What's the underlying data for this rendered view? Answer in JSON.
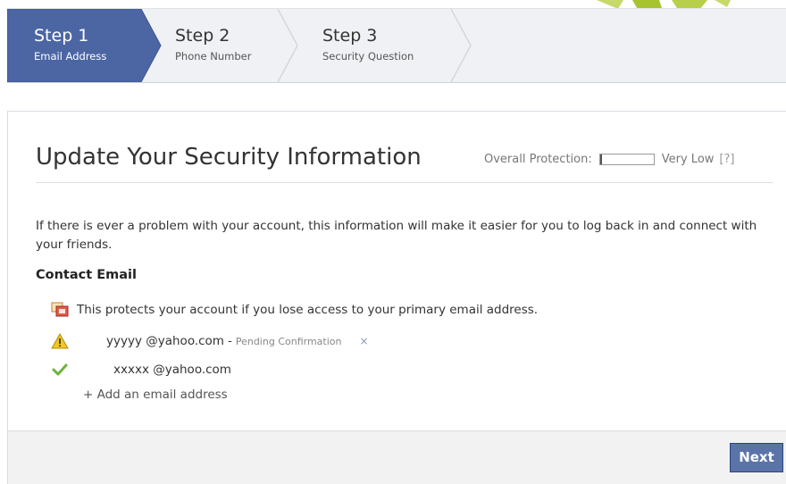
{
  "steps": [
    {
      "title": "Step 1",
      "subtitle": "Email Address",
      "active": true
    },
    {
      "title": "Step 2",
      "subtitle": "Phone Number",
      "active": false
    },
    {
      "title": "Step 3",
      "subtitle": "Security Question",
      "active": false
    }
  ],
  "page": {
    "title": "Update Your Security Information",
    "protection_label": "Overall Protection:",
    "protection_level": "Very Low",
    "protection_fraction": 0.03,
    "help_label": "[?]",
    "intro": "If there is ever a problem with your account, this information will make it easier for you to log back in and connect with your friends."
  },
  "contact_email": {
    "heading": "Contact Email",
    "info_text": "This protects your account if you lose access to your primary email address.",
    "emails": [
      {
        "address": "yyyyy @yahoo.com",
        "separator": "-",
        "status": "Pending Confirmation",
        "status_icon": "warning-icon",
        "remove_label": "×"
      },
      {
        "address": "xxxxx @yahoo.com",
        "status_icon": "check-icon"
      }
    ],
    "add_link": "+ Add an email address"
  },
  "footer": {
    "next_label": "Next"
  },
  "colors": {
    "active_step": "#4c66a4",
    "button_blue": "#5b74a8",
    "warning_yellow": "#f2c624",
    "check_green": "#6cb33f",
    "watermark_green": "#a7c430"
  }
}
